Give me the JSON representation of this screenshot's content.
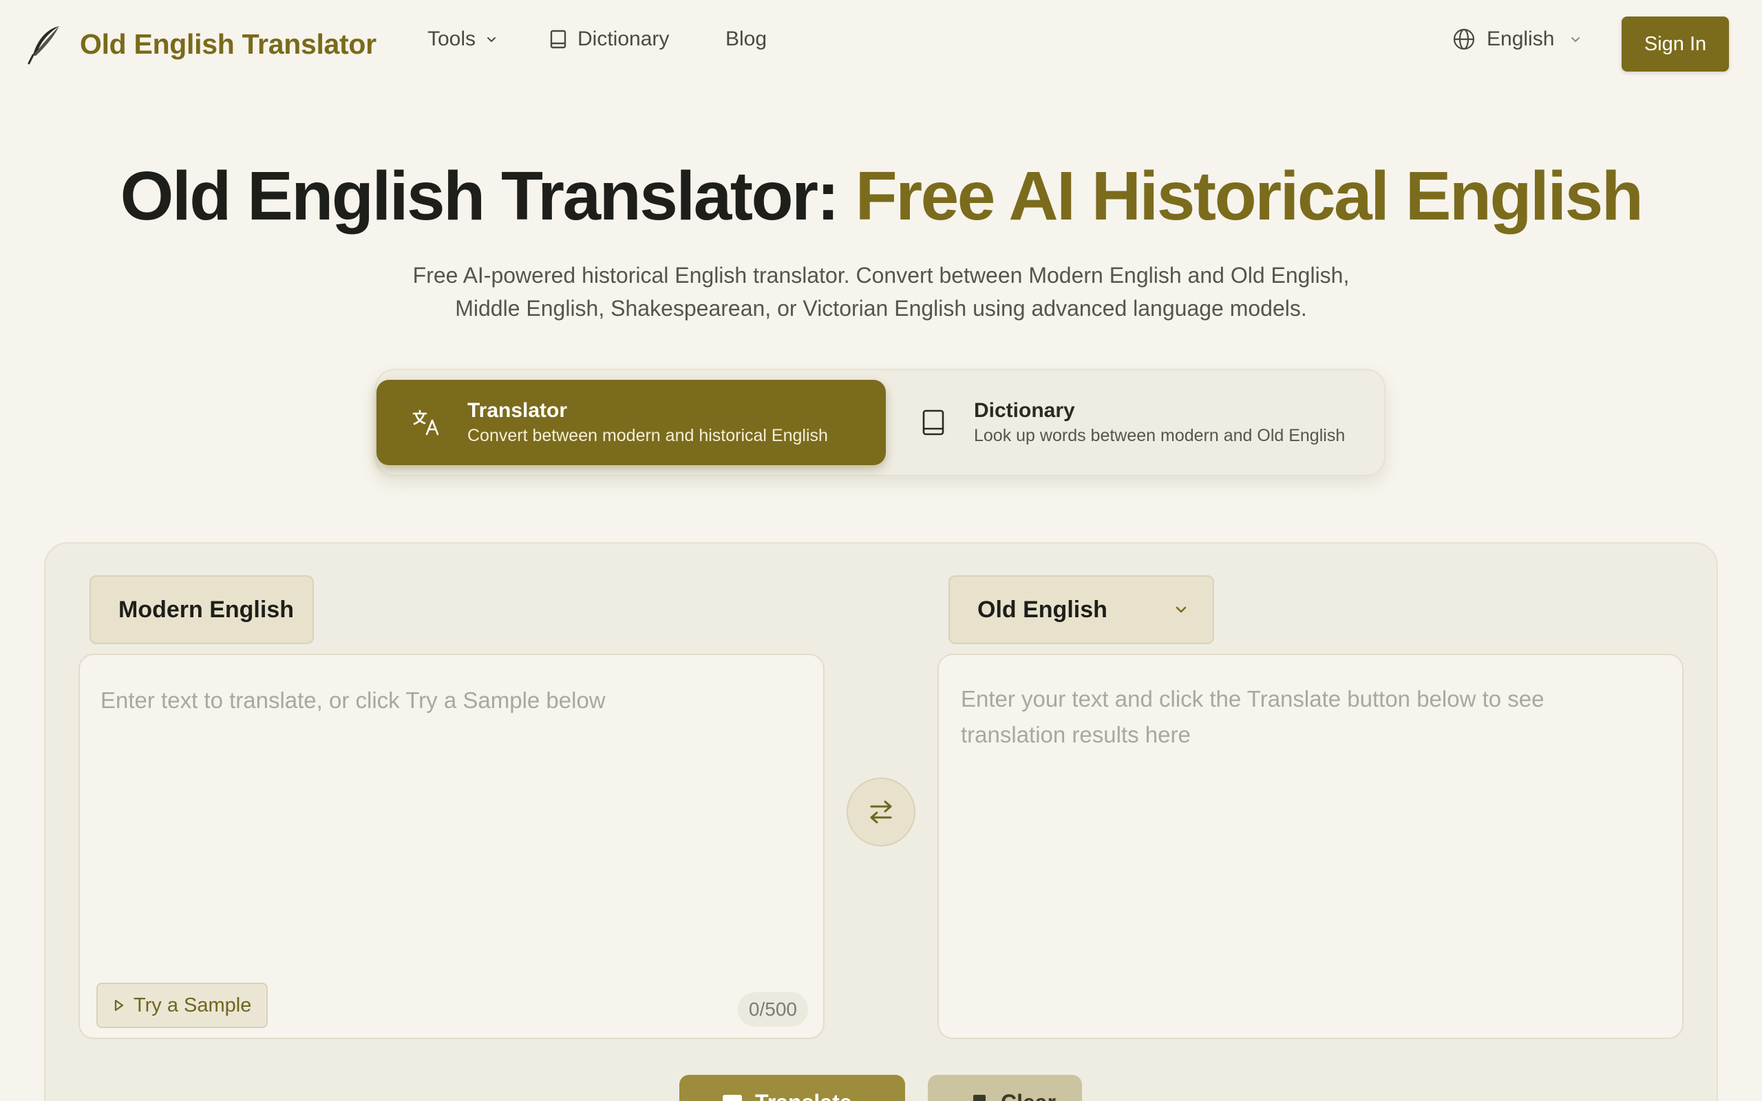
{
  "nav": {
    "brand_name": "Old English Translator",
    "links": {
      "tools": "Tools",
      "dictionary": "Dictionary",
      "blog": "Blog"
    },
    "language": "English",
    "sign_in": "Sign In"
  },
  "hero": {
    "title_main": "Old English Translator: ",
    "title_accent": "Free AI Historical English",
    "subtitle_line1": "Free AI-powered historical English translator. Convert between Modern English and Old English,",
    "subtitle_line2": "Middle English, Shakespearean, or Victorian English using advanced language models."
  },
  "modes": {
    "translator": {
      "title": "Translator",
      "desc": "Convert between modern and historical English",
      "active": true
    },
    "dictionary": {
      "title": "Dictionary",
      "desc": "Look up words between modern and Old English",
      "active": false
    }
  },
  "translator": {
    "source_language": "Modern English",
    "target_language": "Old English",
    "source_placeholder": "Enter text to translate, or click Try a Sample below",
    "source_value": "",
    "target_placeholder": "Enter your text and click the Translate button below to see translation results here",
    "try_sample": "Try a Sample",
    "char_count": "0/500",
    "translate_button": "Translate",
    "clear_button": "Clear"
  },
  "colors": {
    "accent": "#7b6b1c",
    "background": "#f6f4ec",
    "panel": "#efece2"
  },
  "icons": {
    "brand": "quill-icon",
    "dictionary": "book-icon",
    "language": "globe-icon",
    "translator": "translate-icon",
    "swap": "swap-arrows-icon",
    "sample": "play-icon"
  }
}
